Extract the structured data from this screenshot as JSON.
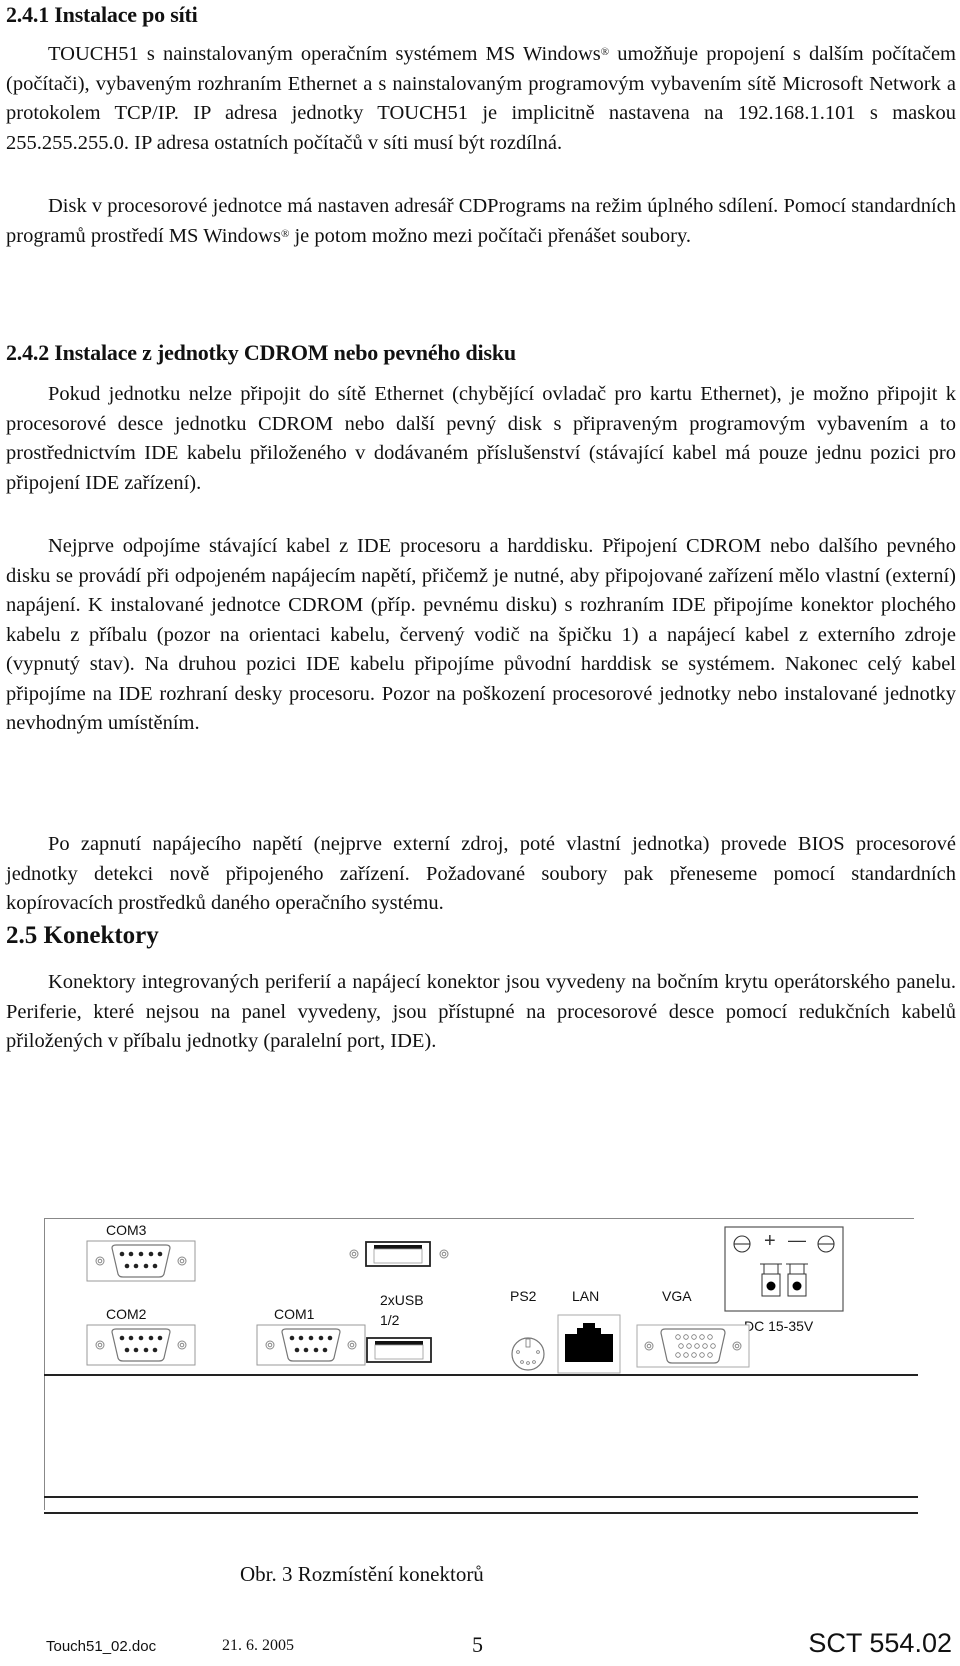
{
  "section_241": {
    "heading": "2.4.1 Instalace po síti",
    "p1_a": "TOUCH51 s nainstalovaným operačním systémem MS Windows",
    "p1_reg": "®",
    "p1_b": " umožňuje propojení s dalším počítačem (počítači), vybaveným rozhraním Ethernet a s nainstalovaným programovým vybavením sítě Microsoft Network a protokolem TCP/IP. IP adresa jednotky TOUCH51 je implicitně nastavena na 192.168.1.101 s maskou 255.255.255.0. IP adresa ostatních počítačů v síti musí být rozdílná.",
    "p2_a": "Disk v procesorové jednotce má nastaven adresář CDPrograms na režim úplného sdílení. Pomocí standardních programů prostředí MS Windows",
    "p2_reg": "®",
    "p2_b": " je potom možno mezi počítači přenášet soubory."
  },
  "section_242": {
    "heading": "2.4.2 Instalace z jednotky CDROM nebo pevného disku",
    "p1": "Pokud jednotku nelze připojit do sítě Ethernet (chybějící ovladač pro kartu Ethernet), je možno připojit k procesorové desce jednotku CDROM nebo další pevný disk s připraveným programovým vybavením a to prostřednictvím IDE kabelu přiloženého v dodávaném příslušenství (stávající kabel má pouze jednu pozici pro připojení IDE zařízení).",
    "p2": "Nejprve odpojíme stávající kabel z IDE procesoru a harddisku. Připojení CDROM nebo dalšího pevného disku se provádí při odpojeném napájecím napětí, přičemž je nutné, aby připojované zařízení mělo vlastní (externí) napájení. K instalované jednotce CDROM (příp. pevnému disku) s rozhraním IDE připojíme  konektor plochého kabelu z příbalu (pozor na orientaci kabelu, červený vodič na špičku 1) a napájecí kabel z externího zdroje (vypnutý stav). Na druhou pozici IDE kabelu připojíme původní harddisk se systémem. Nakonec celý kabel připojíme na IDE rozhraní desky procesoru. Pozor na poškození procesorové jednotky nebo instalované jednotky nevhodným umístěním.",
    "p3": "Po zapnutí napájecího napětí (nejprve externí zdroj, poté vlastní jednotka) provede BIOS procesorové jednotky detekci nově připojeného zařízení. Požadované soubory pak přeneseme pomocí standardních kopírovacích prostředků daného operačního systému."
  },
  "section_25": {
    "heading": "2.5 Konektory",
    "p1": "Konektory integrovaných periferií a napájecí konektor jsou vyvedeny na bočním krytu operátorského panelu. Periferie, které nejsou na panel vyvedeny, jsou přístupné na procesorové desce pomocí redukčních kabelů přiložených v příbalu jednotky (paralelní port, IDE)."
  },
  "figure": {
    "labels": {
      "com3": "COM3",
      "com2": "COM2",
      "com1": "COM1",
      "usb_line1": "2xUSB",
      "usb_line2": "1/2",
      "ps2": "PS2",
      "lan": "LAN",
      "vga": "VGA",
      "dc": "DC 15-35V",
      "plus": "+",
      "minus": "—"
    },
    "caption": "Obr. 3 Rozmístění konektorů"
  },
  "footer": {
    "filename": "Touch51_02.doc",
    "date": "21. 6. 2005",
    "page_number": "5",
    "doc_code": "SCT 554.02"
  }
}
